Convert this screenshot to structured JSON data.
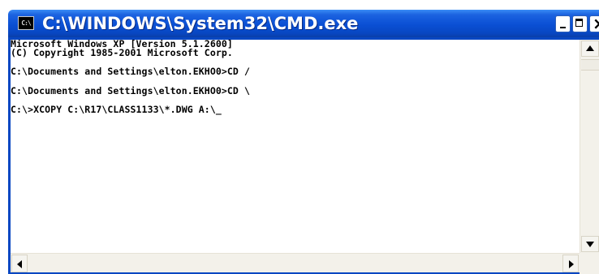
{
  "window": {
    "title": "C:\\WINDOWS\\System32\\CMD.exe",
    "icon": "cmd-console-icon",
    "icon_glyph": "C:\\",
    "controls": [
      "minimize-icon",
      "maximize-icon",
      "close-icon"
    ],
    "titlebar_color": "#0a4fd4"
  },
  "console": {
    "background": "#ffffff",
    "text_color": "#000000",
    "lines": [
      "Microsoft Windows XP [Version 5.1.2600]",
      "(C) Copyright 1985-2001 Microsoft Corp.",
      "",
      "C:\\Documents and Settings\\elton.EKHO0>CD /",
      "",
      "C:\\Documents and Settings\\elton.EKHO0>CD \\",
      "",
      "C:\\>XCOPY C:\\R17\\CLASS1133\\*.DWG A:\\"
    ],
    "cursor": "_"
  },
  "scrollbars": {
    "vertical": {
      "up_icon": "arrow-up-icon",
      "down_icon": "arrow-down-icon"
    },
    "horizontal": {
      "left_icon": "arrow-left-icon",
      "right_icon": "arrow-right-icon"
    }
  }
}
